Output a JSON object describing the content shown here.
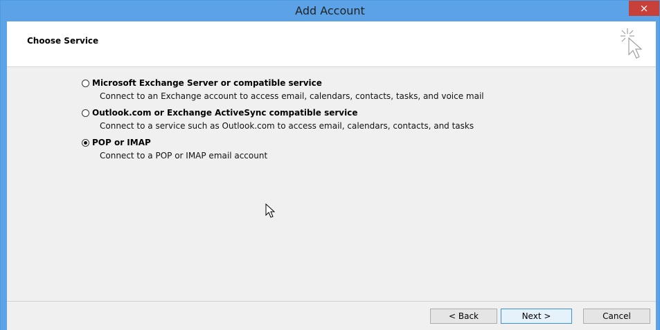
{
  "window": {
    "title": "Add Account",
    "close_symbol": "×"
  },
  "header": {
    "title": "Choose Service",
    "icon": "wizard-cursor-sparkle-icon"
  },
  "options": [
    {
      "label": "Microsoft Exchange Server or compatible service",
      "description": "Connect to an Exchange account to access email, calendars, contacts, tasks, and voice mail",
      "selected": false
    },
    {
      "label": "Outlook.com or Exchange ActiveSync compatible service",
      "description": "Connect to a service such as Outlook.com to access email, calendars, contacts, and tasks",
      "selected": false
    },
    {
      "label": "POP or IMAP",
      "description": "Connect to a POP or IMAP email account",
      "selected": true
    }
  ],
  "buttons": {
    "back": "< Back",
    "next": "Next >",
    "cancel": "Cancel"
  },
  "colors": {
    "title_bar": "#5ba3e6",
    "close": "#c7413a",
    "background": "#f0f0f0"
  }
}
